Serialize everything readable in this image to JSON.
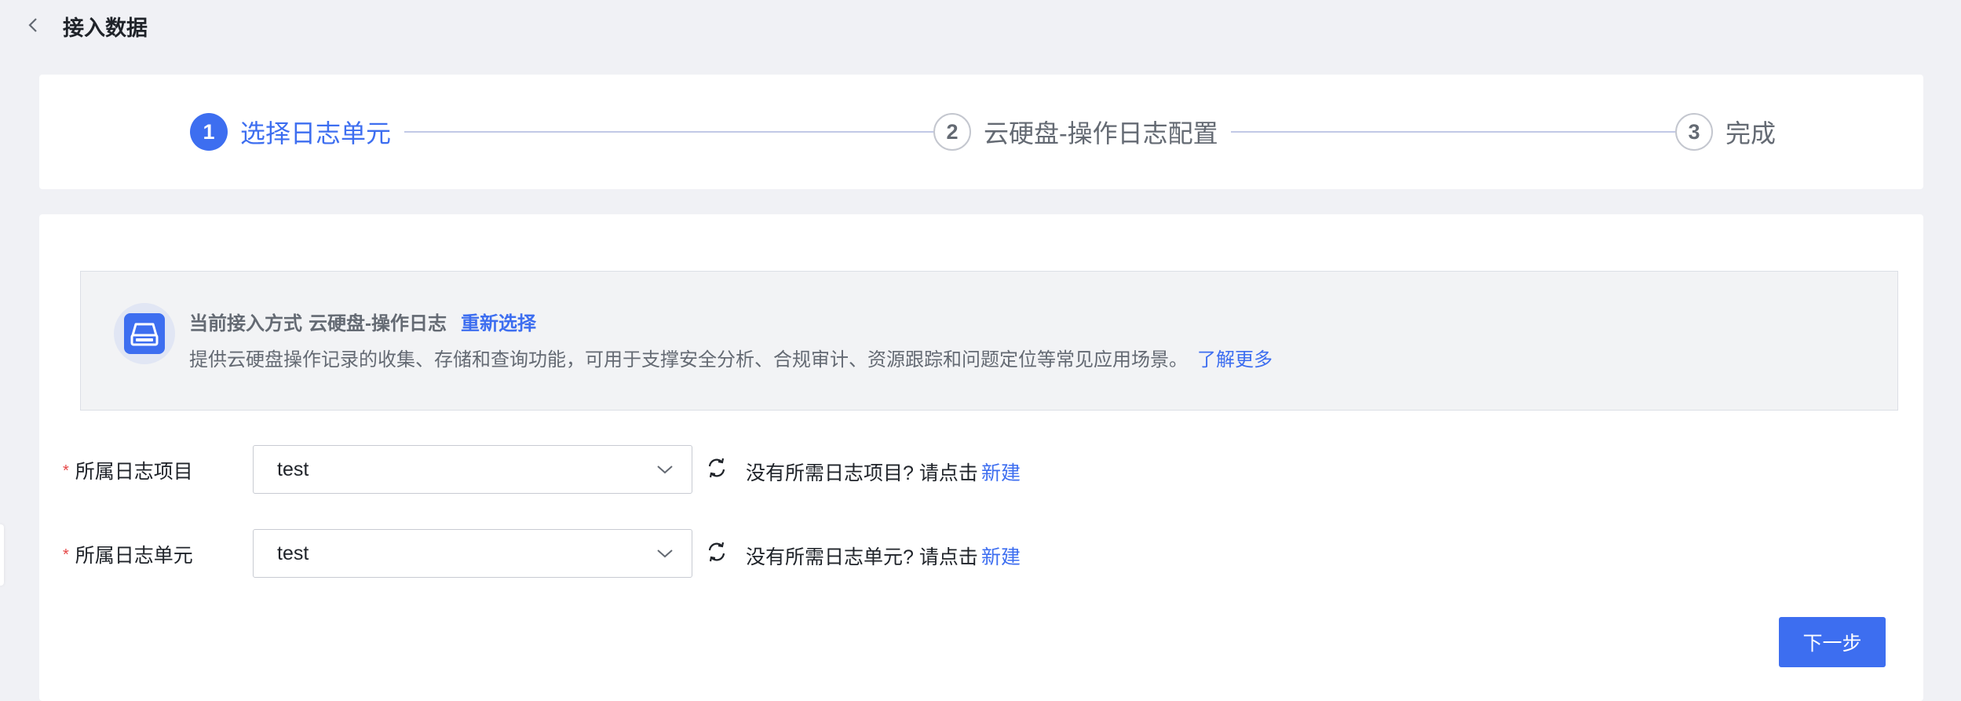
{
  "header": {
    "back_icon": "chevron-left-icon",
    "title": "接入数据"
  },
  "steps": [
    {
      "number": "1",
      "label": "选择日志单元",
      "state": "active"
    },
    {
      "number": "2",
      "label": "云硬盘-操作日志配置",
      "state": "inactive"
    },
    {
      "number": "3",
      "label": "完成",
      "state": "inactive"
    }
  ],
  "info": {
    "icon": "cloud-disk-icon",
    "mode_label": "当前接入方式",
    "mode_value": "云硬盘-操作日志",
    "reselect_label": "重新选择",
    "description": "提供云硬盘操作记录的收集、存储和查询功能，可用于支撑安全分析、合规审计、资源跟踪和问题定位等常见应用场景。",
    "learn_more_label": "了解更多"
  },
  "form": {
    "project": {
      "required_mark": "*",
      "label": "所属日志项目",
      "value": "test",
      "hint": "没有所需日志项目? 请点击",
      "create_label": "新建"
    },
    "unit": {
      "required_mark": "*",
      "label": "所属日志单元",
      "value": "test",
      "hint": "没有所需日志单元? 请点击",
      "create_label": "新建"
    }
  },
  "footer": {
    "next_label": "下一步"
  },
  "colors": {
    "accent": "#3d6ef0",
    "background": "#f0f1f5",
    "required": "#e54545"
  }
}
